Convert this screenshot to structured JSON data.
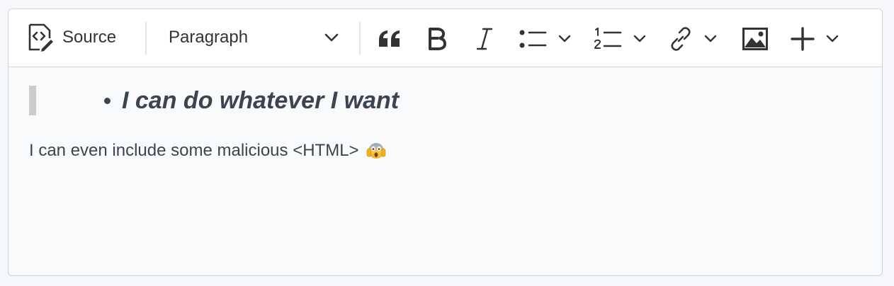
{
  "toolbar": {
    "source_label": "Source",
    "paragraph_select_value": "Paragraph",
    "icons": [
      "source-edit-icon",
      "chevron-down-icon",
      "blockquote-icon",
      "bold-icon",
      "italic-icon",
      "bulleted-list-icon",
      "numbered-list-icon",
      "link-icon",
      "image-icon",
      "plus-icon"
    ]
  },
  "content": {
    "list_item_text": "I can do whatever I want",
    "paragraph_text": "I can even include some malicious <HTML>",
    "emoji_name": "face-screaming-in-fear"
  },
  "colors": {
    "text": "#3d4451",
    "toolbar_bg": "#ffffff",
    "content_bg": "#f8fafc",
    "border": "#ccd3dd",
    "quote_bar": "#cccccc"
  }
}
